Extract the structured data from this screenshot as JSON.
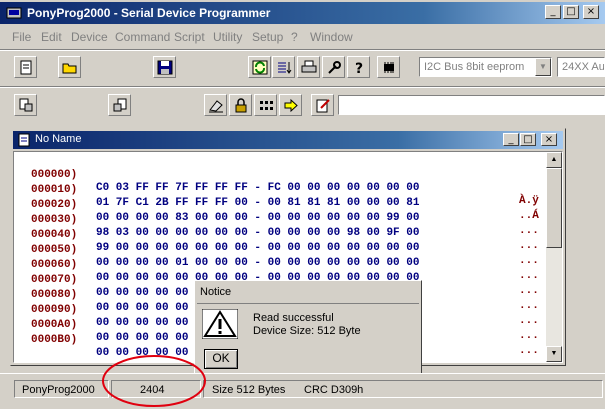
{
  "app": {
    "title": "PonyProg2000 - Serial Device Programmer"
  },
  "window_controls": {
    "minimize": "_",
    "maximize": "□",
    "close": "×"
  },
  "menu": [
    "File",
    "Edit",
    "Device",
    "Command",
    "Script",
    "Utility",
    "Setup",
    "?",
    "Window"
  ],
  "toolbar1": {
    "icons": [
      "new-document-icon",
      "open-folder-icon",
      "save-disk-icon",
      "reload-icon",
      "edit-list-icon",
      "print-icon",
      "wrench-icon",
      "help-icon",
      "chip-icon"
    ],
    "device_family": "I2C Bus 8bit eeprom",
    "device_type": "24XX Au"
  },
  "toolbar2": {
    "icons": [
      "read-device-icon",
      "write-device-icon",
      "erase-icon",
      "lock-icon",
      "dots-icon",
      "arrow-right-icon",
      "edit-note-icon"
    ]
  },
  "document": {
    "title": "No Name",
    "rows": [
      {
        "addr": "000000)",
        "bytes": "C0 03 FF FF 7F FF FF FF - FC 00 00 00 00 00 00 00",
        "ascii": "À.ÿ"
      },
      {
        "addr": "000010)",
        "bytes": "01 7F C1 2B FF FF FF 00 - 00 81 81 81 00 00 00 81",
        "ascii": "..Á"
      },
      {
        "addr": "000020)",
        "bytes": "00 00 00 00 83 00 00 00 - 00 00 00 00 00 00 99 00",
        "ascii": "..."
      },
      {
        "addr": "000030)",
        "bytes": "98 03 00 00 00 00 00 00 - 00 00 00 00 98 00 9F 00",
        "ascii": "..."
      },
      {
        "addr": "000040)",
        "bytes": "99 00 00 00 00 00 00 00 - 00 00 00 00 00 00 00 00",
        "ascii": "..."
      },
      {
        "addr": "000050)",
        "bytes": "00 00 00 00 01 00 00 00 - 00 00 00 00 00 00 00 00",
        "ascii": "..."
      },
      {
        "addr": "000060)",
        "bytes": "00 00 00 00 00 00 00 00 - 00 00 00 00 00 00 00 00",
        "ascii": "..."
      },
      {
        "addr": "000070)",
        "bytes": "00 00 00 00 00 00 00 00 - 00 00 00 00 00 00 00 00",
        "ascii": "..."
      },
      {
        "addr": "000080)",
        "bytes": "00 00 00 00 00 00 00 00 - 00 00 00 00 00 00 00 00",
        "ascii": "..."
      },
      {
        "addr": "000090)",
        "bytes": "00 00 00 00 00 00 00 00 - 00 00 00 00 00 00 00 00",
        "ascii": "..."
      },
      {
        "addr": "0000A0)",
        "bytes": "00 00 00 00 00 00 00 00 - 00 00 00 00 00 00 00 00",
        "ascii": "..."
      },
      {
        "addr": "0000B0)",
        "bytes": "00 00 00 00 00 00 00 00 - 00 00 00 00 00 00 00 00",
        "ascii": "..."
      }
    ]
  },
  "dialog": {
    "title": "Notice",
    "line1": "Read successful",
    "line2": "Device Size: 512 Byte",
    "ok": "OK"
  },
  "status": {
    "app": "PonyProg2000",
    "code": "2404",
    "size": "Size  512 Bytes",
    "crc": "CRC  D309h"
  },
  "colors": {
    "address": "#800000",
    "bytes": "#000080",
    "highlight_circle": "#e0000f"
  }
}
